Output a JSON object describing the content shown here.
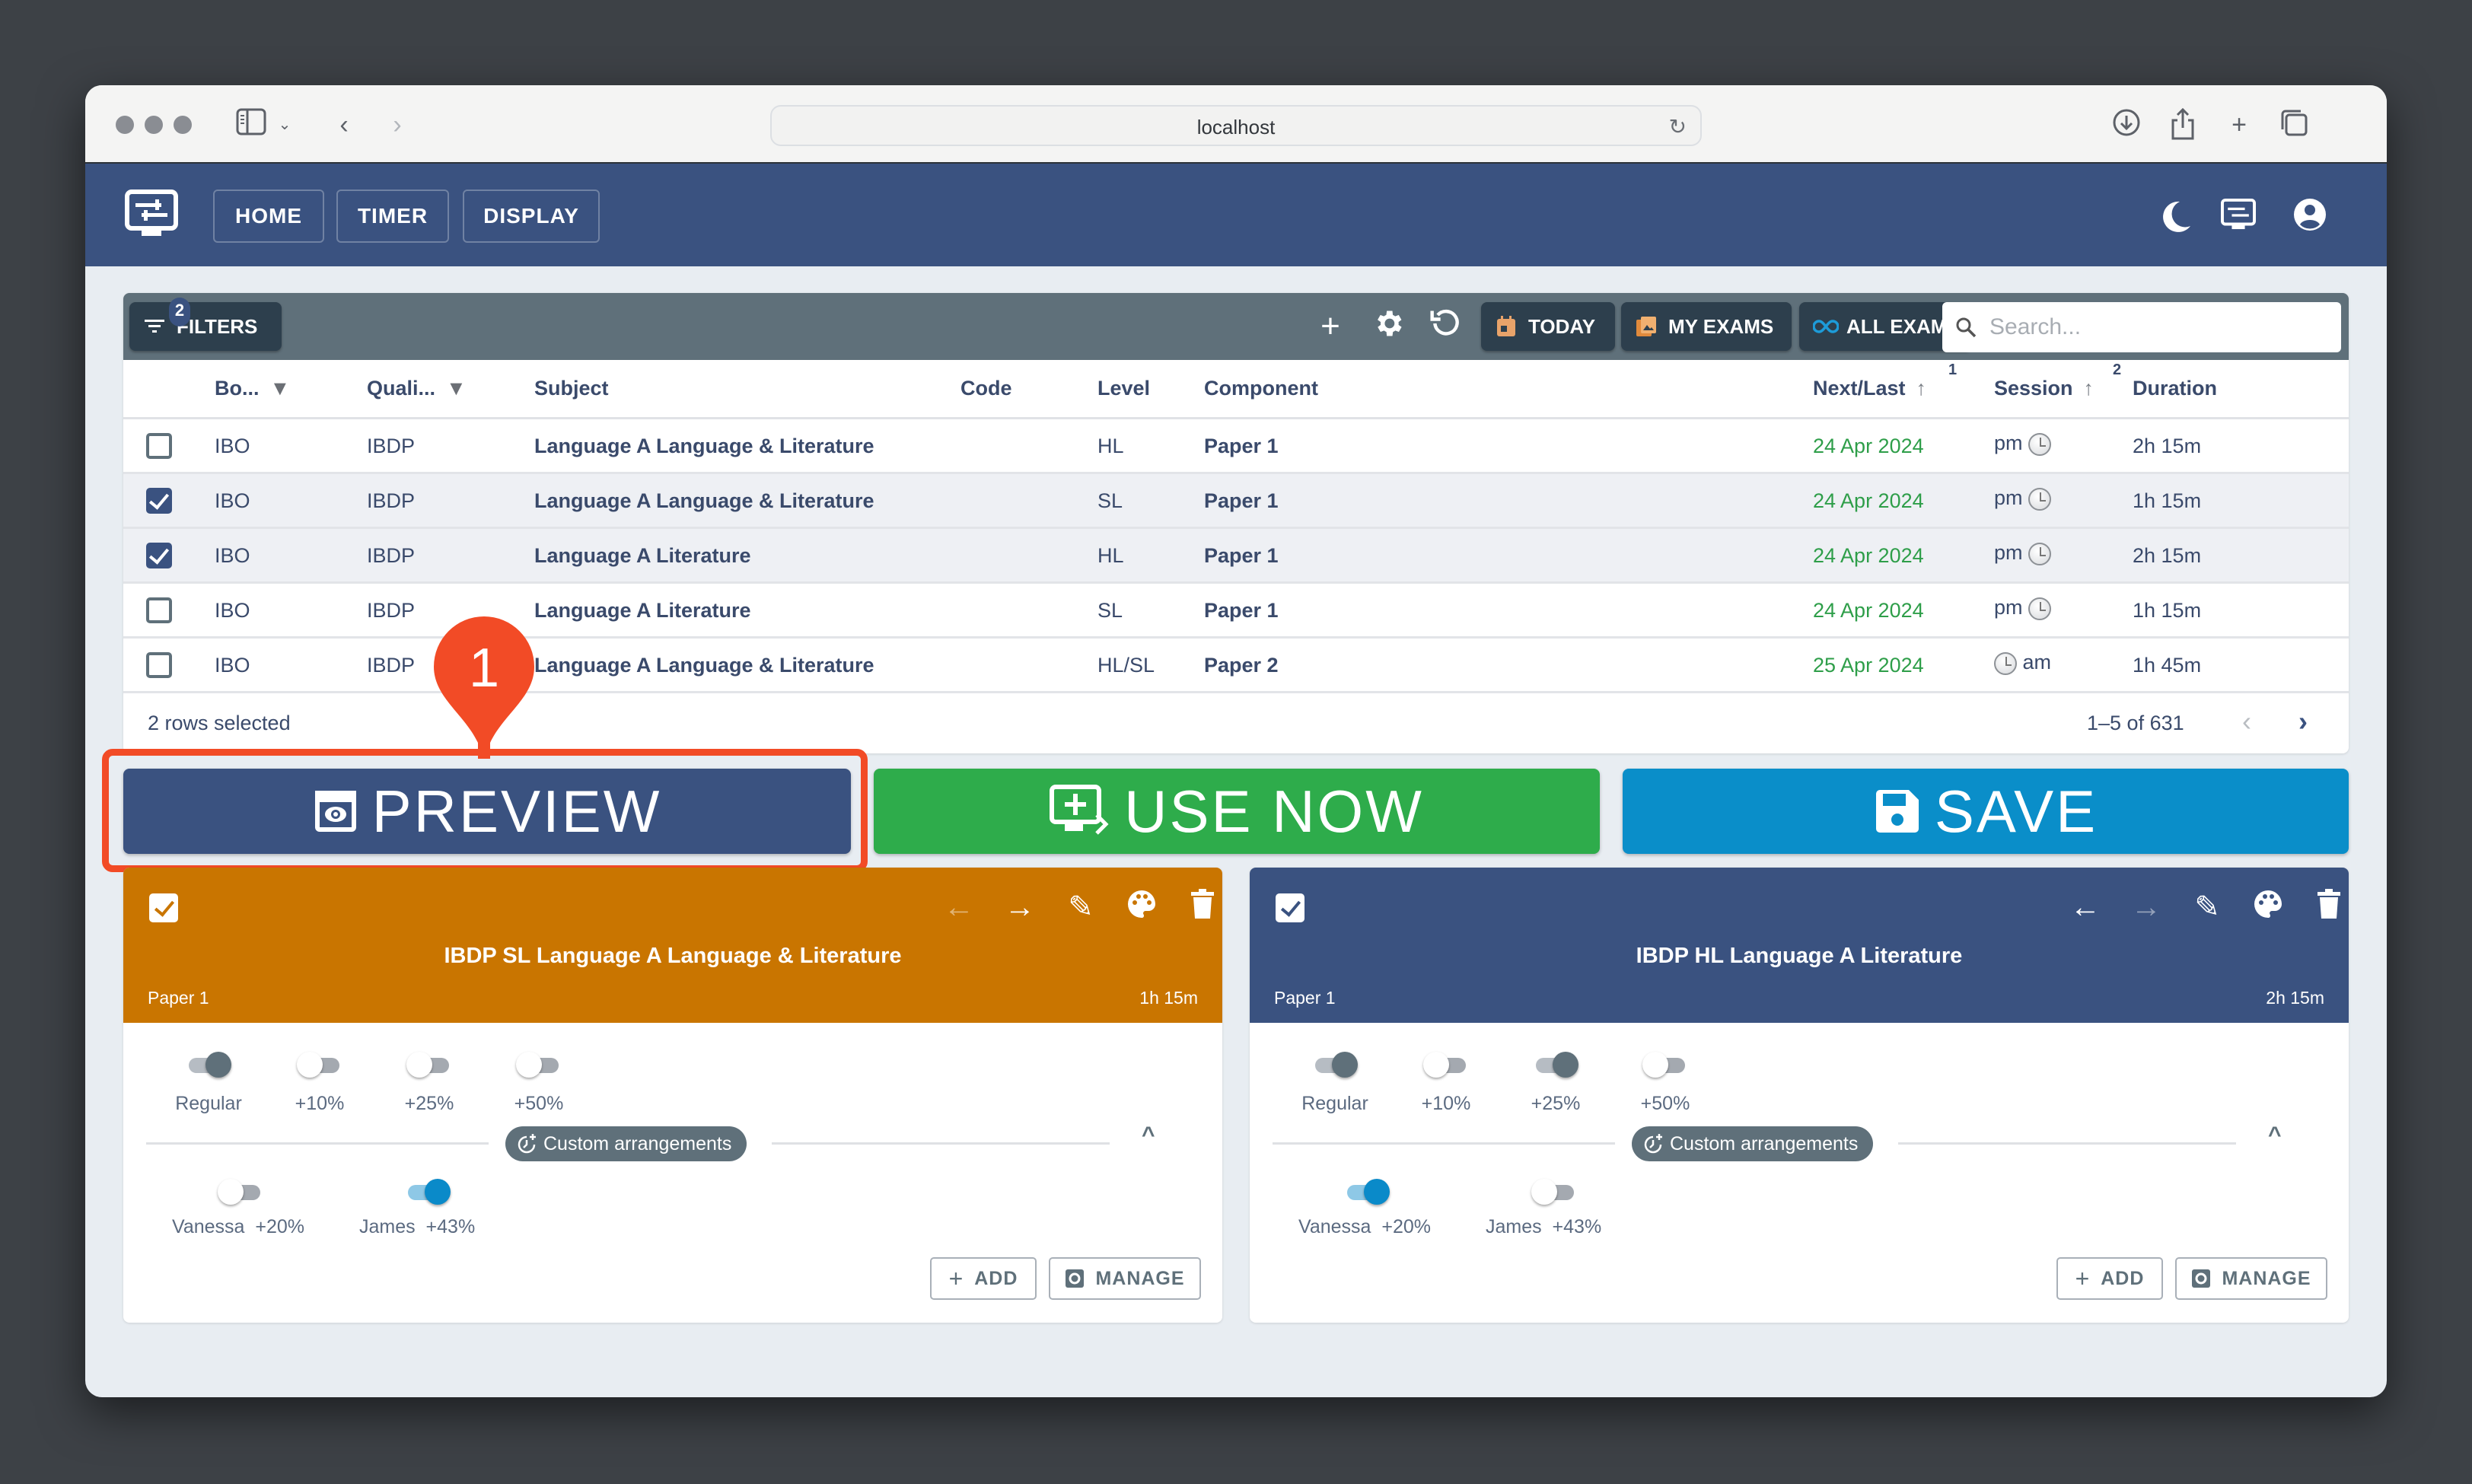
{
  "browser": {
    "url": "localhost",
    "icons": [
      "sidebar-icon",
      "chevron-down-icon",
      "back-icon",
      "forward-icon",
      "reload-icon",
      "download-icon",
      "share-icon",
      "new-tab-icon",
      "tabs-icon"
    ]
  },
  "appbar": {
    "nav": [
      {
        "label": "HOME"
      },
      {
        "label": "TIMER"
      },
      {
        "label": "DISPLAY"
      }
    ],
    "icons": [
      "dark-mode-icon",
      "display-settings-icon",
      "account-icon"
    ]
  },
  "toolbar": {
    "filters_label": "FILTERS",
    "filters_count": "2",
    "today_label": "TODAY",
    "my_exams_label": "MY EXAMS",
    "all_exams_label": "ALL EXAMS",
    "search_placeholder": "Search...",
    "colors": {
      "today": "#e8a36a",
      "my_exams": "#e08a3c",
      "all_exams": "#1d9bd8"
    }
  },
  "table": {
    "columns": [
      {
        "label": "Bo...",
        "filter": true
      },
      {
        "label": "Quali...",
        "filter": true
      },
      {
        "label": "Subject"
      },
      {
        "label": "Code"
      },
      {
        "label": "Level"
      },
      {
        "label": "Component"
      },
      {
        "label": "Next/Last",
        "sort": "asc",
        "sort_order": "1"
      },
      {
        "label": "Session",
        "sort": "asc",
        "sort_order": "2"
      },
      {
        "label": "Duration"
      }
    ],
    "rows": [
      {
        "selected": false,
        "board": "IBO",
        "qualification": "IBDP",
        "subject": "Language A Language & Literature",
        "code": "",
        "level": "HL",
        "component": "Paper 1",
        "date": "24 Apr 2024",
        "session": "pm",
        "duration": "2h 15m"
      },
      {
        "selected": true,
        "board": "IBO",
        "qualification": "IBDP",
        "subject": "Language A Language & Literature",
        "code": "",
        "level": "SL",
        "component": "Paper 1",
        "date": "24 Apr 2024",
        "session": "pm",
        "duration": "1h 15m"
      },
      {
        "selected": true,
        "board": "IBO",
        "qualification": "IBDP",
        "subject": "Language A Literature",
        "code": "",
        "level": "HL",
        "component": "Paper 1",
        "date": "24 Apr 2024",
        "session": "pm",
        "duration": "2h 15m"
      },
      {
        "selected": false,
        "board": "IBO",
        "qualification": "IBDP",
        "subject": "Language A Literature",
        "code": "",
        "level": "SL",
        "component": "Paper 1",
        "date": "24 Apr 2024",
        "session": "pm",
        "duration": "1h 15m"
      },
      {
        "selected": false,
        "board": "IBO",
        "qualification": "IBDP",
        "subject": "Language A Language & Literature",
        "code": "",
        "level": "HL/SL",
        "component": "Paper 2",
        "date": "25 Apr 2024",
        "session": "am",
        "duration": "1h 45m"
      }
    ],
    "selection_status": "2 rows selected",
    "pagination": "1–5 of 631"
  },
  "actions": {
    "preview_label": "PREVIEW",
    "use_now_label": "USE NOW",
    "save_label": "SAVE",
    "colors": {
      "preview": "#3a5280",
      "use_now": "#2eac4b",
      "save": "#0a8ec9"
    }
  },
  "annotation": {
    "step": "1",
    "color": "#f24b26"
  },
  "cards": [
    {
      "title": "IBDP SL Language A Language & Literature",
      "component": "Paper 1",
      "duration": "1h 15m",
      "color": "#c97500",
      "checked": true,
      "prev_enabled": false,
      "next_enabled": true,
      "extra_time": [
        {
          "label": "Regular",
          "on": true
        },
        {
          "label": "+10%",
          "on": false
        },
        {
          "label": "+25%",
          "on": false
        },
        {
          "label": "+50%",
          "on": false
        }
      ],
      "custom_label": "Custom arrangements",
      "custom": [
        {
          "name": "Vanessa",
          "extra": "+20%",
          "on": false
        },
        {
          "name": "James",
          "extra": "+43%",
          "on": true
        }
      ],
      "add_label": "ADD",
      "manage_label": "MANAGE"
    },
    {
      "title": "IBDP HL Language A Literature",
      "component": "Paper 1",
      "duration": "2h 15m",
      "color": "#3a5280",
      "checked": true,
      "prev_enabled": true,
      "next_enabled": false,
      "extra_time": [
        {
          "label": "Regular",
          "on": true
        },
        {
          "label": "+10%",
          "on": false
        },
        {
          "label": "+25%",
          "on": true
        },
        {
          "label": "+50%",
          "on": false
        }
      ],
      "custom_label": "Custom arrangements",
      "custom": [
        {
          "name": "Vanessa",
          "extra": "+20%",
          "on": true
        },
        {
          "name": "James",
          "extra": "+43%",
          "on": false
        }
      ],
      "add_label": "ADD",
      "manage_label": "MANAGE"
    }
  ]
}
